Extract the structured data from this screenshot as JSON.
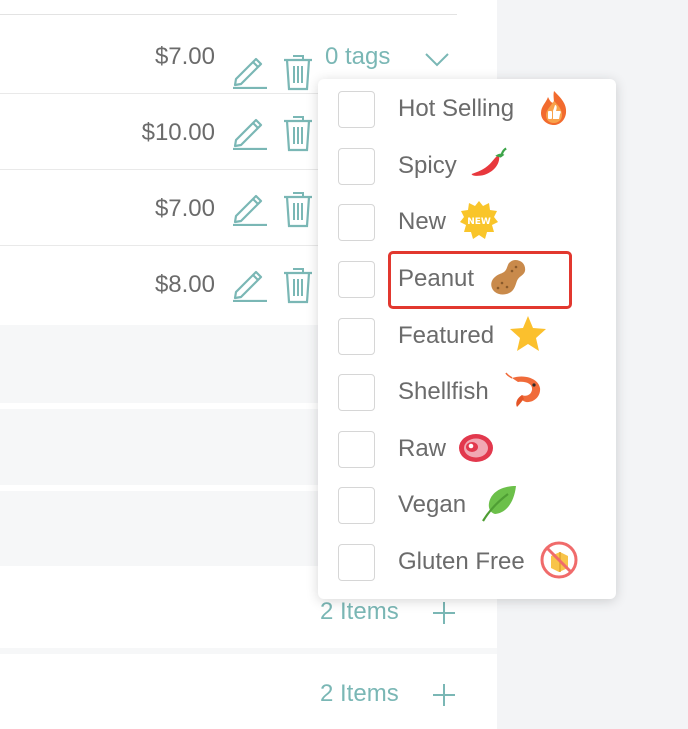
{
  "rows": [
    {
      "price": "$7.00"
    },
    {
      "price": "$10.00"
    },
    {
      "price": "$7.00"
    },
    {
      "price": "$8.00"
    }
  ],
  "tags_trigger": {
    "label": "0 tags"
  },
  "item_rows": [
    {
      "label": "2 Items"
    },
    {
      "label": "2 Items"
    }
  ],
  "tag_options": [
    {
      "label": "Hot Selling",
      "icon": "fire-thumbs-up-icon"
    },
    {
      "label": "Spicy",
      "icon": "chili-pepper-icon"
    },
    {
      "label": "New",
      "icon": "new-badge-icon",
      "badge_text": "NEW"
    },
    {
      "label": "Peanut",
      "icon": "peanut-icon"
    },
    {
      "label": "Featured",
      "icon": "star-icon"
    },
    {
      "label": "Shellfish",
      "icon": "shrimp-icon"
    },
    {
      "label": "Raw",
      "icon": "raw-meat-icon"
    },
    {
      "label": "Vegan",
      "icon": "leaf-icon"
    },
    {
      "label": "Gluten Free",
      "icon": "gluten-free-icon"
    }
  ],
  "colors": {
    "accent": "#7ab7b5",
    "highlight": "#e2382f"
  }
}
